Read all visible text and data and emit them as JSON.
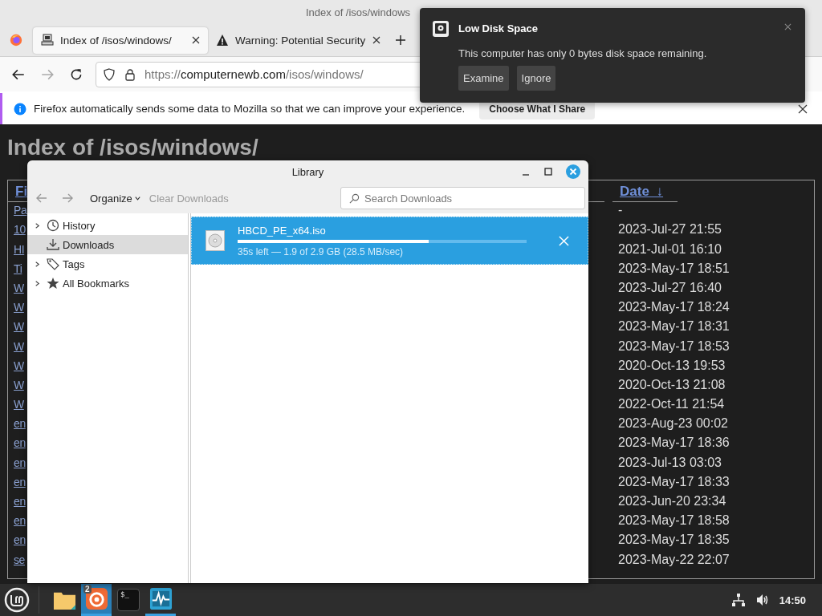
{
  "browser": {
    "title": "Index of /isos/windows",
    "tabs": [
      {
        "label": "Index of /isos/windows/",
        "selected": true,
        "kind": "computer"
      },
      {
        "label": "Warning: Potential Security",
        "selected": false,
        "kind": "warning"
      }
    ],
    "url": {
      "scheme": "https://",
      "host": "computernewb.com",
      "path": "/isos/windows/"
    },
    "infobar": {
      "message": "Firefox automatically sends some data to Mozilla so that we can improve your experience.",
      "button": "Choose What I Share"
    }
  },
  "page": {
    "heading": "Index of /isos/windows/",
    "columns": [
      {
        "label": "Fi"
      },
      {
        "label": "Date ↓"
      }
    ],
    "rows": [
      {
        "name": "Pa",
        "date": "-"
      },
      {
        "name": "10",
        "date": "2023-Jul-27 21:55"
      },
      {
        "name": "HI",
        "date": "2021-Jul-01 16:10"
      },
      {
        "name": "Ti",
        "date": "2023-May-17 18:51"
      },
      {
        "name": "W",
        "date": "2023-Jul-27 16:40"
      },
      {
        "name": "W",
        "date": "2023-May-17 18:24"
      },
      {
        "name": "W",
        "date": "2023-May-17 18:31"
      },
      {
        "name": "W",
        "date": "2023-May-17 18:53"
      },
      {
        "name": "W",
        "date": "2020-Oct-13 19:53"
      },
      {
        "name": "W",
        "date": "2020-Oct-13 21:08"
      },
      {
        "name": "W",
        "date": "2022-Oct-11 21:54"
      },
      {
        "name": "en",
        "date": "2023-Aug-23 00:02"
      },
      {
        "name": "en",
        "date": "2023-May-17 18:36"
      },
      {
        "name": "en",
        "date": "2023-Jul-13 03:03"
      },
      {
        "name": "en",
        "date": "2023-May-17 18:33"
      },
      {
        "name": "en",
        "date": "2023-Jun-20 23:34"
      },
      {
        "name": "en",
        "date": "2023-May-17 18:58"
      },
      {
        "name": "en",
        "date": "2023-May-17 18:35"
      },
      {
        "name": "se",
        "date": "2023-May-22 22:07"
      }
    ]
  },
  "library": {
    "title": "Library",
    "organize": "Organize",
    "clear": "Clear Downloads",
    "search": {
      "placeholder": "Search Downloads"
    },
    "tree": [
      {
        "label": "History",
        "kind": "clock",
        "expanded": false,
        "selected": false
      },
      {
        "label": "Downloads",
        "kind": "download",
        "selected": true
      },
      {
        "label": "Tags",
        "kind": "tag",
        "expanded": false,
        "selected": false
      },
      {
        "label": "All Bookmarks",
        "kind": "star",
        "expanded": false,
        "selected": false
      }
    ],
    "downloads": [
      {
        "name": "HBCD_PE_x64.iso",
        "level": 0.66,
        "status": "35s left — 1.9 of 2.9 GB (28.5 MB/sec)",
        "selected": true
      }
    ]
  },
  "notification": {
    "title": "Low Disk Space",
    "body": "This computer has only 0 bytes disk space remaining.",
    "buttons": [
      "Examine",
      "Ignore"
    ]
  },
  "taskbar": {
    "apps": [
      {
        "kind": "files",
        "selected": false,
        "running": false
      },
      {
        "kind": "firefox",
        "selected": true,
        "running": true,
        "badge": "2"
      },
      {
        "kind": "terminal",
        "selected": false,
        "running": false,
        "text": "$_"
      },
      {
        "kind": "monitor",
        "selected": false,
        "running": true
      }
    ],
    "clock": "14:50"
  }
}
